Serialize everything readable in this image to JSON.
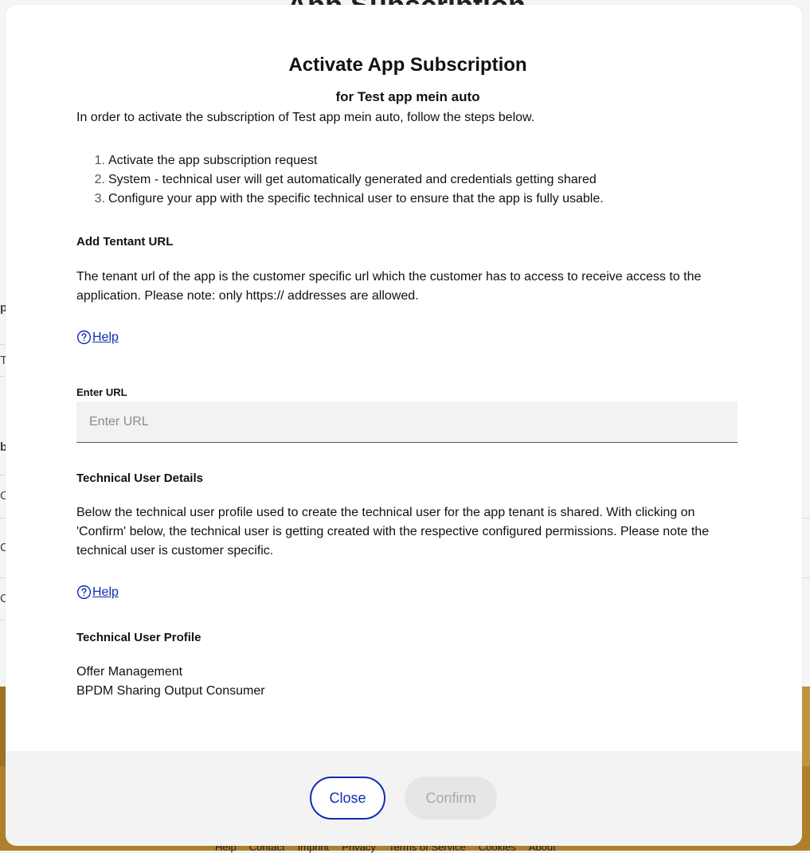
{
  "background": {
    "title_fragment": "App Subscription",
    "footer_links": [
      "Help",
      "Contact",
      "Imprint",
      "Privacy",
      "Terms of Service",
      "Cookies",
      "About"
    ]
  },
  "modal": {
    "title": "Activate App Subscription",
    "subtitle": "for Test app mein auto",
    "intro": "In order to activate the subscription of Test app mein auto, follow the steps below.",
    "steps": [
      {
        "num": "1.",
        "text": "Activate the app subscription request"
      },
      {
        "num": "2.",
        "text": "System - technical user will get automatically generated and credentials getting shared"
      },
      {
        "num": "3.",
        "text": "Configure your app with the specific technical user to ensure that the app is fully usable."
      }
    ],
    "tenant": {
      "heading": "Add Tentant URL",
      "description": "The tenant url of the app is the customer specific url which the customer has to access to receive access to the application. Please note: only https:// addresses are allowed.",
      "help_label": "Help",
      "field_label": "Enter URL",
      "field_placeholder": "Enter URL",
      "field_value": ""
    },
    "technical_user": {
      "heading": "Technical User Details",
      "description": "Below the technical user profile used to create the technical user for the app tenant is shared. With clicking on 'Confirm' below, the technical user is getting created with the respective configured permissions. Please note the technical user is customer specific.",
      "help_label": "Help",
      "profile_heading": "Technical User Profile",
      "profiles": [
        "Offer Management",
        "BPDM Sharing Output Consumer"
      ]
    },
    "buttons": {
      "close": "Close",
      "confirm": "Confirm",
      "confirm_disabled": true
    }
  },
  "colors": {
    "accent": "#0f2db3",
    "footer_bg": "#f3f3f3",
    "banner": "#b7862e"
  }
}
